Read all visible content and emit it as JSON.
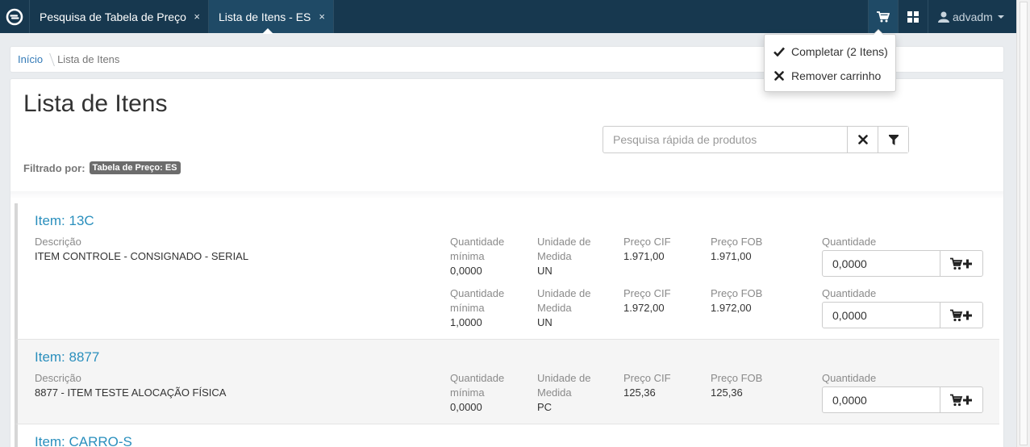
{
  "tabs": [
    {
      "label": "Pesquisa de Tabela de Preço",
      "close": "×"
    },
    {
      "label": "Lista de Itens - ES",
      "close": "×"
    }
  ],
  "user": {
    "name": "advadm"
  },
  "breadcrumb": {
    "home": "Início",
    "current": "Lista de Itens"
  },
  "page": {
    "title": "Lista de Itens",
    "search_placeholder": "Pesquisa rápida de produtos",
    "filter_label": "Filtrado por:",
    "filter_badge": "Tabela de Preço: ES"
  },
  "labels": {
    "description": "Descrição",
    "min_qty_1": "Quantidade",
    "min_qty_2": "mínima",
    "unit_1": "Unidade de",
    "unit_2": "Medida",
    "price_cif": "Preço CIF",
    "price_fob": "Preço FOB",
    "quantity": "Quantidade"
  },
  "items": [
    {
      "title": "Item: 13C",
      "description": "ITEM CONTROLE - CONSIGNADO - SERIAL",
      "rows": [
        {
          "min_qty": "0,0000",
          "unit": "UN",
          "cif": "1.971,00",
          "fob": "1.971,00",
          "qty": "0,0000"
        },
        {
          "min_qty": "1,0000",
          "unit": "UN",
          "cif": "1.972,00",
          "fob": "1.972,00",
          "qty": "0,0000"
        }
      ]
    },
    {
      "title": "Item: 8877",
      "description": "8877 - ITEM TESTE ALOCAÇÃO FÍSICA",
      "rows": [
        {
          "min_qty": "0,0000",
          "unit": "PC",
          "cif": "125,36",
          "fob": "125,36",
          "qty": "0,0000"
        }
      ]
    },
    {
      "title": "Item: CARRO-S"
    }
  ],
  "cart_menu": {
    "complete": "Completar (2 Itens)",
    "remove": "Remover carrinho"
  },
  "colors": {
    "topbar": "#17384f",
    "link": "#2a8fbd"
  }
}
